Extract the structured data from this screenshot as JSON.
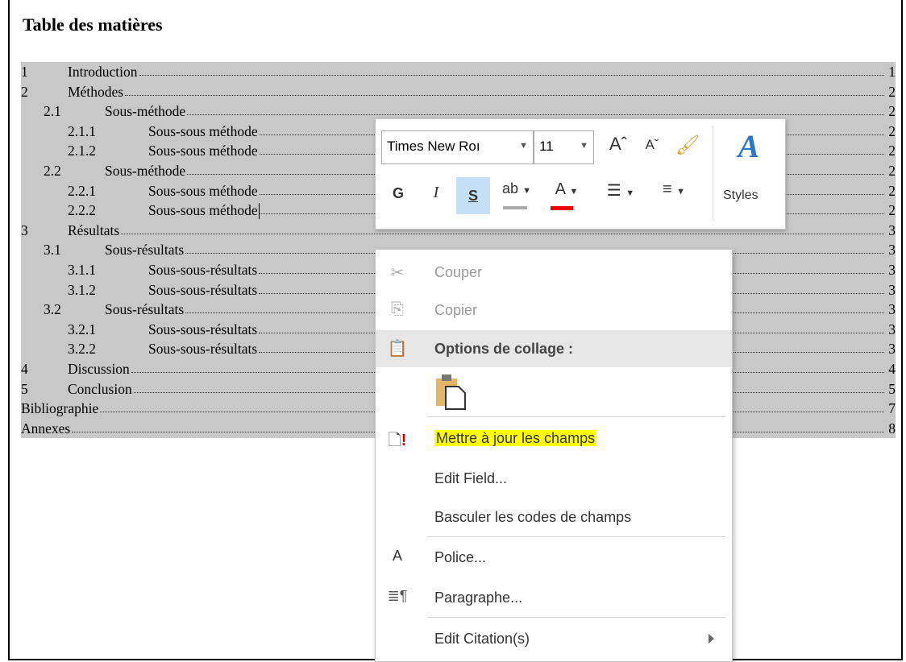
{
  "document": {
    "title": "Table des matières",
    "toc": [
      {
        "level": 1,
        "num": "1",
        "label": "Introduction",
        "page": "1"
      },
      {
        "level": 1,
        "num": "2",
        "label": "Méthodes",
        "page": "2"
      },
      {
        "level": 2,
        "num": "2.1",
        "label": "Sous-méthode",
        "page": "2"
      },
      {
        "level": 3,
        "num": "2.1.1",
        "label": "Sous-sous méthode",
        "page": "2"
      },
      {
        "level": 3,
        "num": "2.1.2",
        "label": "Sous-sous méthode",
        "page": "2"
      },
      {
        "level": 2,
        "num": "2.2",
        "label": "Sous-méthode",
        "page": "2"
      },
      {
        "level": 3,
        "num": "2.2.1",
        "label": "Sous-sous méthode",
        "page": "2"
      },
      {
        "level": 3,
        "num": "2.2.2",
        "label": "Sous-sous méthode",
        "page": "2"
      },
      {
        "level": 1,
        "num": "3",
        "label": "Résultats",
        "page": "3"
      },
      {
        "level": 2,
        "num": "3.1",
        "label": "Sous-résultats",
        "page": "3"
      },
      {
        "level": 3,
        "num": "3.1.1",
        "label": "Sous-sous-résultats",
        "page": "3"
      },
      {
        "level": 3,
        "num": "3.1.2",
        "label": "Sous-sous-résultats",
        "page": "3"
      },
      {
        "level": 2,
        "num": "3.2",
        "label": "Sous-résultats",
        "page": "3"
      },
      {
        "level": 3,
        "num": "3.2.1",
        "label": "Sous-sous-résultats",
        "page": "3"
      },
      {
        "level": 3,
        "num": "3.2.2",
        "label": "Sous-sous-résultats",
        "page": "3"
      },
      {
        "level": 1,
        "num": "4",
        "label": "Discussion",
        "page": "4"
      },
      {
        "level": 1,
        "num": "5",
        "label": "Conclusion",
        "page": "5"
      },
      {
        "level": 0,
        "num": "",
        "label": "Bibliographie",
        "page": "7"
      },
      {
        "level": 0,
        "num": "",
        "label": "Annexes",
        "page": "8"
      }
    ]
  },
  "mini_toolbar": {
    "font_name": "Times New Roı",
    "font_size": "11",
    "grow_font": "Aˆ",
    "shrink_font": "Aˇ",
    "bold": "G",
    "italic": "I",
    "shadow": "S",
    "highlight": "ab",
    "font_color": "A",
    "styles_icon": "A",
    "styles_label": "Styles"
  },
  "context_menu": {
    "items": [
      {
        "icon": "scissors-icon",
        "label": "Couper",
        "enabled": false
      },
      {
        "icon": "copy-icon",
        "label": "Copier",
        "enabled": false
      },
      {
        "icon": "clipboard-icon",
        "label": "Options de collage :",
        "header": true
      },
      {
        "icon": "update-field-icon",
        "label": "Mettre à jour les champs",
        "highlighted": true
      },
      {
        "icon": "",
        "label": "Edit Field..."
      },
      {
        "icon": "",
        "label": "Basculer les codes de champs"
      },
      {
        "icon": "font-icon",
        "label": "Police..."
      },
      {
        "icon": "paragraph-icon",
        "label": "Paragraphe..."
      },
      {
        "icon": "",
        "label": "Edit Citation(s)",
        "submenu": true
      }
    ]
  },
  "colors": {
    "selection": "#c8c8c8",
    "highlight_yellow": "#ffff00",
    "font_color_red": "#e00000",
    "styles_blue": "#2b79c7"
  }
}
